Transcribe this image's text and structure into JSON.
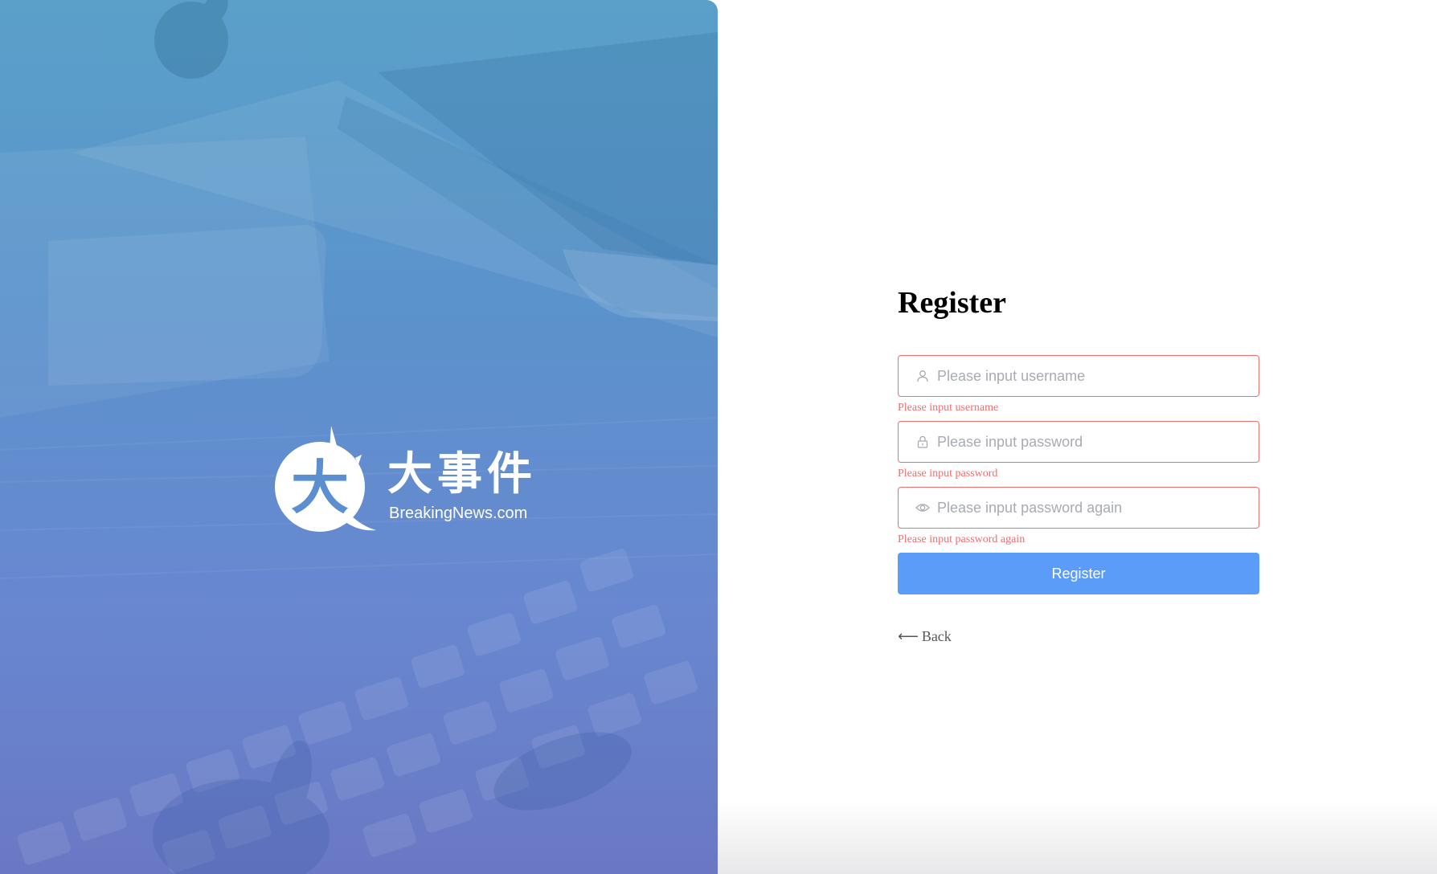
{
  "brand": {
    "name_cn": "大事件",
    "domain": "BreakingNews.com",
    "mark_glyph": "大"
  },
  "form": {
    "title": "Register",
    "username": {
      "placeholder": "Please input username",
      "value": "",
      "error": "Please input username",
      "icon": "user-icon"
    },
    "password": {
      "placeholder": "Please input password",
      "value": "",
      "error": "Please input password",
      "icon": "lock-icon"
    },
    "repassword": {
      "placeholder": "Please input password again",
      "value": "",
      "error": "Please input password again",
      "icon": "eye-icon"
    },
    "submit_label": "Register",
    "back_arrow": "⟵",
    "back_label": "Back"
  },
  "colors": {
    "accent": "#5b9cf8",
    "error": "#f56c6c",
    "hero_top": "#5aa0c9",
    "hero_bottom": "#6a78c4"
  }
}
